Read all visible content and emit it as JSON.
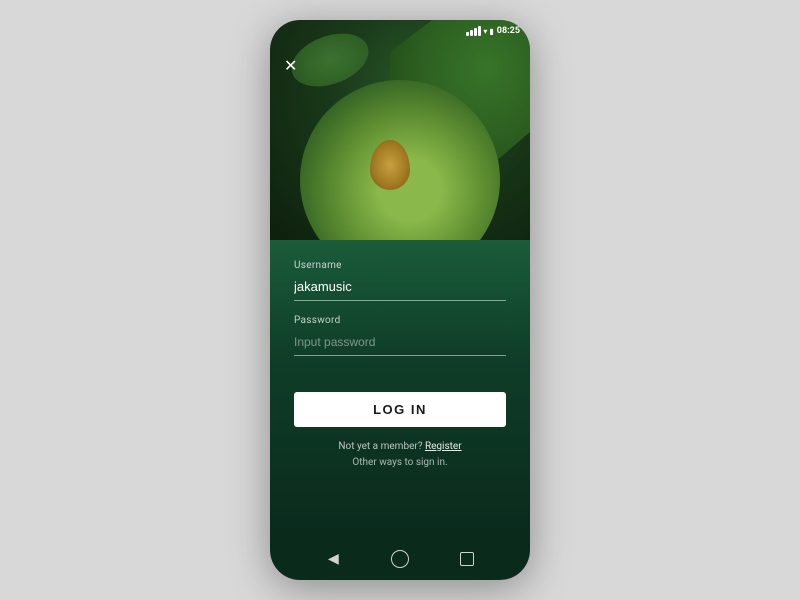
{
  "status_bar": {
    "time": "08:25"
  },
  "close_button": "✕",
  "form": {
    "username_label": "Username",
    "username_value": "jakamusic",
    "password_label": "Password",
    "password_placeholder": "Input password"
  },
  "login_button": "LOG IN",
  "member_text": "Not yet a member?",
  "register_link": "Register",
  "other_signin": "Other ways to sign in.",
  "nav": {
    "back": "◀",
    "home": "",
    "recents": ""
  }
}
